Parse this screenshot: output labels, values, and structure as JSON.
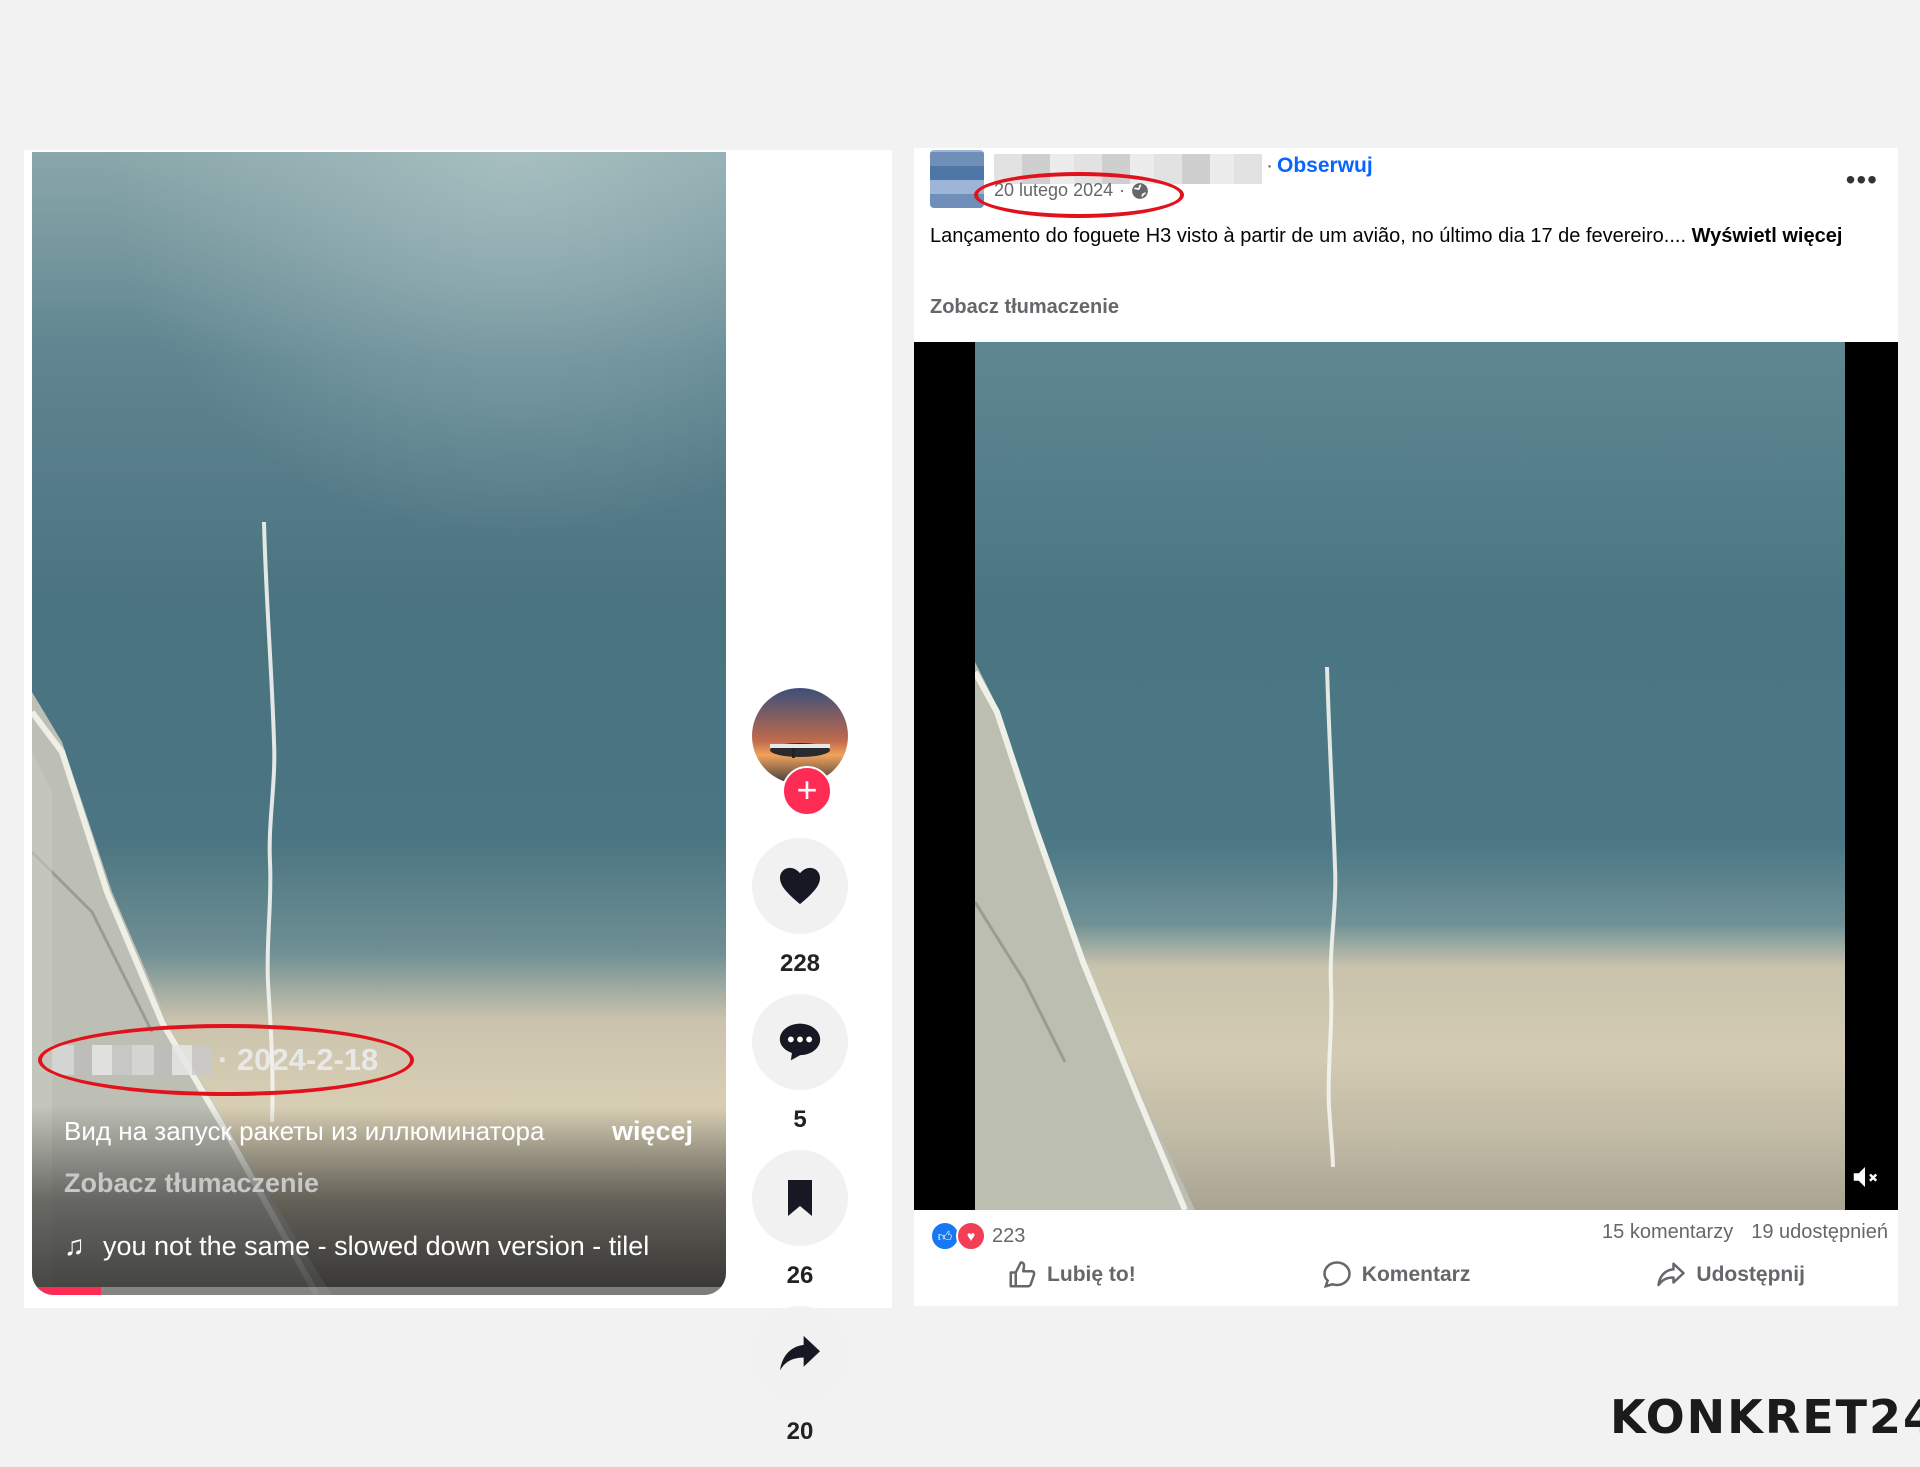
{
  "tiktok": {
    "date": "· 2024-2-18",
    "description": "Вид на запуск ракеты из иллюминатора",
    "more_label": "więcej",
    "translate_label": "Zobacz tłumaczenie",
    "music": "you not the same - slowed down version - tilel",
    "likes": "228",
    "comments": "5",
    "saves": "26",
    "shares": "20",
    "progress": 0.1,
    "accent": "#fe2c55"
  },
  "facebook": {
    "follow_label": "Obserwuj",
    "date": "20 lutego 2024",
    "post_text": "Lançamento do foguete H3 visto à partir de um avião, no último dia 17 de fevereiro....",
    "see_more": "Wyświetl więcej",
    "translate_label": "Zobacz tłumaczenie",
    "reaction_count": "223",
    "comments": "15 komentarzy",
    "shares": "19 udostępnień",
    "like_label": "Lubię to!",
    "comment_label": "Komentarz",
    "share_label": "Udostępnij",
    "accent": "#0866ff"
  },
  "logo": "KONKRET24",
  "highlight_color": "#e1121c"
}
